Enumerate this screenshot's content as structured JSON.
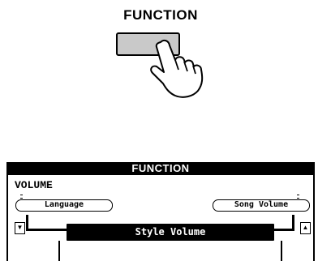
{
  "button": {
    "label": "FUNCTION"
  },
  "lcd": {
    "title": "FUNCTION",
    "group": "VOLUME",
    "prev_item": "Language",
    "next_item": "Song Volume",
    "selected_item": "Style Volume"
  },
  "icons": {
    "hand": "pointing-hand-icon",
    "down": "down-arrow-icon",
    "up": "up-arrow-icon"
  }
}
